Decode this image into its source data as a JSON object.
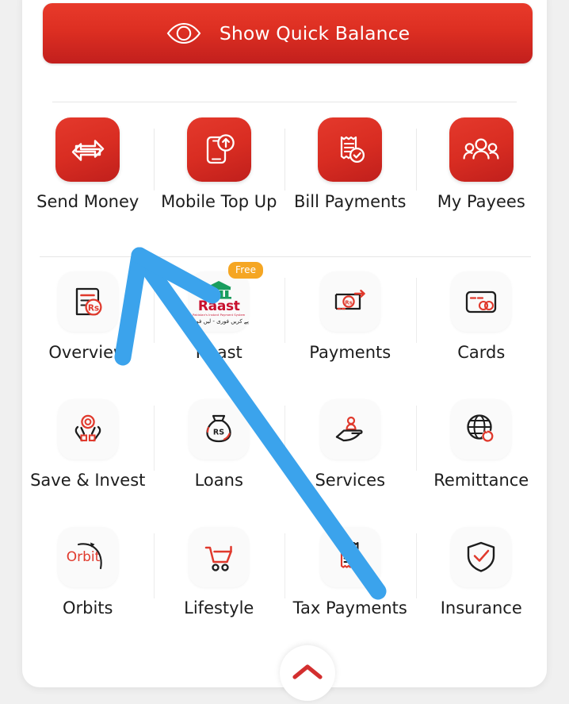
{
  "quick_balance": {
    "label": "Show Quick Balance",
    "icon": "eye-icon",
    "bg_gradient_top": "#e83a2b",
    "bg_gradient_bottom": "#c21f1d"
  },
  "quick_actions": [
    {
      "label": "Send Money",
      "icon": "transfer-arrows-icon"
    },
    {
      "label": "Mobile Top Up",
      "icon": "mobile-topup-icon"
    },
    {
      "label": "Bill Payments",
      "icon": "bill-check-icon"
    },
    {
      "label": "My Payees",
      "icon": "people-group-icon"
    }
  ],
  "services": [
    [
      {
        "label": "Overview",
        "icon": "statement-rupee-icon",
        "badge": null
      },
      {
        "label": "Raast",
        "icon": "raast-logo-icon",
        "badge": "Free",
        "logo_word": "Raast",
        "logo_tagline": "Pakistan's Instant Payment System",
        "logo_urdu": "پے کریں فوری - لیں فوری"
      },
      {
        "label": "Payments",
        "icon": "payment-rupee-arrow-icon",
        "badge": null
      },
      {
        "label": "Cards",
        "icon": "credit-card-icon",
        "badge": null
      }
    ],
    [
      {
        "label": "Save & Invest",
        "icon": "hands-savings-icon",
        "badge": null
      },
      {
        "label": "Loans",
        "icon": "money-bag-rupee-icon",
        "badge": null
      },
      {
        "label": "Services",
        "icon": "hand-person-icon",
        "badge": null
      },
      {
        "label": "Remittance",
        "icon": "globe-refresh-icon",
        "badge": null
      }
    ],
    [
      {
        "label": "Orbits",
        "icon": "orbit-text-icon",
        "badge": null,
        "logo_word": "Orbit"
      },
      {
        "label": "Lifestyle",
        "icon": "shopping-cart-icon",
        "badge": null
      },
      {
        "label": "Tax Payments",
        "icon": "tax-documents-icon",
        "badge": null
      },
      {
        "label": "Insurance",
        "icon": "shield-check-icon",
        "badge": null
      }
    ]
  ],
  "scroll_up": {
    "icon": "chevron-up-icon",
    "color": "#d32f2f"
  },
  "annotation": {
    "type": "arrow",
    "color": "#3ba3ec",
    "points": "tip(175,320) -> tail(477,745)"
  },
  "theme": {
    "brand_red": "#d92d22",
    "icon_dark": "#1d1d1d",
    "icon_red": "#e0392c",
    "page_bg": "#f0f0f0",
    "card_bg": "#ffffff",
    "badge_orange": "#f5a623",
    "raast_green": "#1a9d5e",
    "raast_red": "#c8102e"
  }
}
